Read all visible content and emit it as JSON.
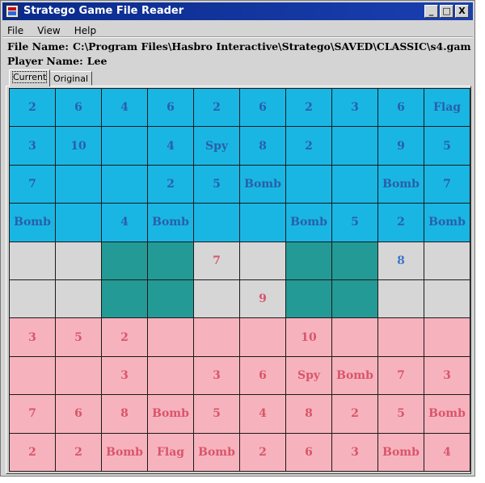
{
  "window": {
    "title": "Stratego Game File Reader",
    "buttons": {
      "minimize": "_",
      "maximize": "□",
      "close": "X"
    }
  },
  "menu": [
    "File",
    "View",
    "Help"
  ],
  "info": {
    "file_label": "File Name:",
    "file_value": "C:\\Program Files\\Hasbro Interactive\\Stratego\\SAVED\\CLASSIC\\s4.gam",
    "player_label": "Player Name:",
    "player_value": "Lee"
  },
  "tabs": [
    {
      "label": "Current",
      "active": true
    },
    {
      "label": "Original",
      "active": false
    }
  ],
  "colors": {
    "blue_cell": "#19b6e4",
    "blue_text": "#2a5fa8",
    "red_cell": "#f7b3bd",
    "red_text": "#d8556b",
    "empty_cell": "#d6d6d6",
    "lake_cell": "#249a96"
  },
  "board": [
    [
      {
        "t": "blue",
        "v": "2"
      },
      {
        "t": "blue",
        "v": "6"
      },
      {
        "t": "blue",
        "v": "4"
      },
      {
        "t": "blue",
        "v": "6"
      },
      {
        "t": "blue",
        "v": "2"
      },
      {
        "t": "blue",
        "v": "6"
      },
      {
        "t": "blue",
        "v": "2"
      },
      {
        "t": "blue",
        "v": "3"
      },
      {
        "t": "blue",
        "v": "6"
      },
      {
        "t": "blue",
        "v": "Flag"
      }
    ],
    [
      {
        "t": "blue",
        "v": "3"
      },
      {
        "t": "blue",
        "v": "10"
      },
      {
        "t": "blue",
        "v": ""
      },
      {
        "t": "blue",
        "v": "4"
      },
      {
        "t": "blue",
        "v": "Spy"
      },
      {
        "t": "blue",
        "v": "8"
      },
      {
        "t": "blue",
        "v": "2"
      },
      {
        "t": "blue",
        "v": ""
      },
      {
        "t": "blue",
        "v": "9"
      },
      {
        "t": "blue",
        "v": "5"
      }
    ],
    [
      {
        "t": "blue",
        "v": "7"
      },
      {
        "t": "blue",
        "v": ""
      },
      {
        "t": "blue",
        "v": ""
      },
      {
        "t": "blue",
        "v": "2"
      },
      {
        "t": "blue",
        "v": "5"
      },
      {
        "t": "blue",
        "v": "Bomb"
      },
      {
        "t": "blue",
        "v": ""
      },
      {
        "t": "blue",
        "v": ""
      },
      {
        "t": "blue",
        "v": "Bomb"
      },
      {
        "t": "blue",
        "v": "7"
      }
    ],
    [
      {
        "t": "blue",
        "v": "Bomb"
      },
      {
        "t": "blue",
        "v": ""
      },
      {
        "t": "blue",
        "v": "4"
      },
      {
        "t": "blue",
        "v": "Bomb"
      },
      {
        "t": "blue",
        "v": ""
      },
      {
        "t": "blue",
        "v": ""
      },
      {
        "t": "blue",
        "v": "Bomb"
      },
      {
        "t": "blue",
        "v": "5"
      },
      {
        "t": "blue",
        "v": "2"
      },
      {
        "t": "blue",
        "v": "Bomb"
      }
    ],
    [
      {
        "t": "empty",
        "v": ""
      },
      {
        "t": "empty",
        "v": ""
      },
      {
        "t": "lake",
        "v": ""
      },
      {
        "t": "lake",
        "v": ""
      },
      {
        "t": "empty",
        "v": "7",
        "c": "red"
      },
      {
        "t": "empty",
        "v": ""
      },
      {
        "t": "lake",
        "v": ""
      },
      {
        "t": "lake",
        "v": ""
      },
      {
        "t": "empty",
        "v": "8"
      },
      {
        "t": "empty",
        "v": ""
      }
    ],
    [
      {
        "t": "empty",
        "v": ""
      },
      {
        "t": "empty",
        "v": ""
      },
      {
        "t": "lake",
        "v": ""
      },
      {
        "t": "lake",
        "v": ""
      },
      {
        "t": "empty",
        "v": ""
      },
      {
        "t": "empty",
        "v": "9",
        "c": "red"
      },
      {
        "t": "lake",
        "v": ""
      },
      {
        "t": "lake",
        "v": ""
      },
      {
        "t": "empty",
        "v": ""
      },
      {
        "t": "empty",
        "v": ""
      }
    ],
    [
      {
        "t": "red",
        "v": "3"
      },
      {
        "t": "red",
        "v": "5"
      },
      {
        "t": "red",
        "v": "2"
      },
      {
        "t": "red",
        "v": ""
      },
      {
        "t": "red",
        "v": ""
      },
      {
        "t": "red",
        "v": ""
      },
      {
        "t": "red",
        "v": "10"
      },
      {
        "t": "red",
        "v": ""
      },
      {
        "t": "red",
        "v": ""
      },
      {
        "t": "red",
        "v": ""
      }
    ],
    [
      {
        "t": "red",
        "v": ""
      },
      {
        "t": "red",
        "v": ""
      },
      {
        "t": "red",
        "v": "3"
      },
      {
        "t": "red",
        "v": ""
      },
      {
        "t": "red",
        "v": "3"
      },
      {
        "t": "red",
        "v": "6"
      },
      {
        "t": "red",
        "v": "Spy"
      },
      {
        "t": "red",
        "v": "Bomb"
      },
      {
        "t": "red",
        "v": "7"
      },
      {
        "t": "red",
        "v": "3"
      }
    ],
    [
      {
        "t": "red",
        "v": "7"
      },
      {
        "t": "red",
        "v": "6"
      },
      {
        "t": "red",
        "v": "8"
      },
      {
        "t": "red",
        "v": "Bomb"
      },
      {
        "t": "red",
        "v": "5"
      },
      {
        "t": "red",
        "v": "4"
      },
      {
        "t": "red",
        "v": "8"
      },
      {
        "t": "red",
        "v": "2"
      },
      {
        "t": "red",
        "v": "5"
      },
      {
        "t": "red",
        "v": "Bomb"
      }
    ],
    [
      {
        "t": "red",
        "v": "2"
      },
      {
        "t": "red",
        "v": "2"
      },
      {
        "t": "red",
        "v": "Bomb"
      },
      {
        "t": "red",
        "v": "Flag"
      },
      {
        "t": "red",
        "v": "Bomb"
      },
      {
        "t": "red",
        "v": "2"
      },
      {
        "t": "red",
        "v": "6"
      },
      {
        "t": "red",
        "v": "3"
      },
      {
        "t": "red",
        "v": "Bomb"
      },
      {
        "t": "red",
        "v": "4"
      }
    ]
  ]
}
